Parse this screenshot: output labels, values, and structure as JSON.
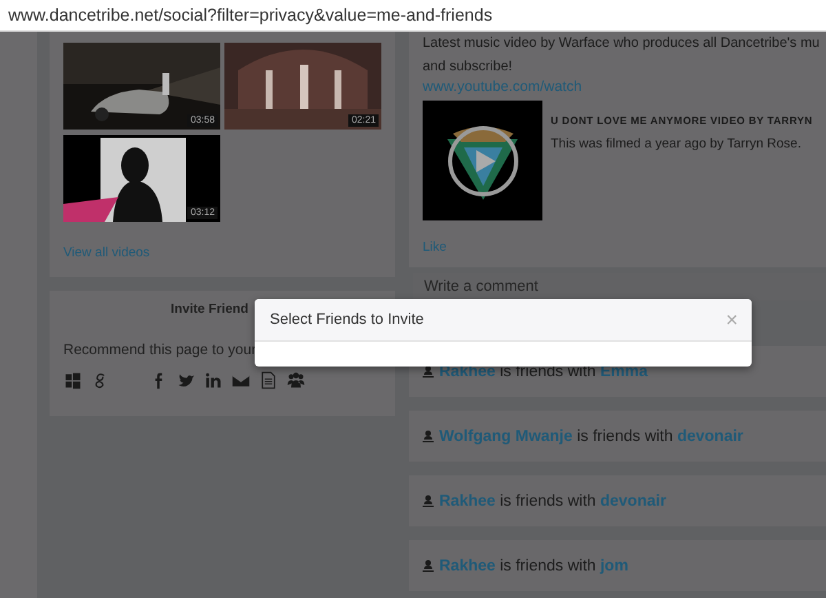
{
  "address_bar": {
    "url": "www.dancetribe.net/social?filter=privacy&value=me-and-friends"
  },
  "videos": {
    "items": [
      {
        "duration": "03:58",
        "kind": "car"
      },
      {
        "duration": "02:21",
        "kind": "hall"
      },
      {
        "duration": "03:12",
        "kind": "silhouette"
      }
    ],
    "view_all": "View all videos"
  },
  "invite_panel": {
    "title": "Invite Friend",
    "text": "Recommend this page to your",
    "share_icons": [
      {
        "kind": "windows"
      },
      {
        "kind": "google"
      },
      {
        "kind": "facebook"
      },
      {
        "kind": "twitter"
      },
      {
        "kind": "linkedin"
      },
      {
        "kind": "email"
      },
      {
        "kind": "document"
      },
      {
        "kind": "group"
      }
    ]
  },
  "post": {
    "text": "Latest music video by Warface who produces all Dancetribe's mu",
    "text_2": "and subscribe!",
    "link": "www.youtube.com/watch",
    "embed": {
      "title": "U DONT LOVE ME ANYMORE VIDEO BY TARRYN",
      "description": "This was filmed a year ago by Tarryn Rose."
    },
    "like": "Like"
  },
  "comment": {
    "placeholder": "Write a comment"
  },
  "activity": [
    {
      "user": "Rakhee",
      "verb": "is friends with",
      "friend": "Emma"
    },
    {
      "user": "Wolfgang Mwanje",
      "verb": "is friends with",
      "friend": "devonair"
    },
    {
      "user": "Rakhee",
      "verb": "is friends with",
      "friend": "devonair"
    },
    {
      "user": "Rakhee",
      "verb": "is friends with",
      "friend": "jom"
    }
  ],
  "modal": {
    "title": "Select Friends to Invite",
    "close": "×"
  }
}
